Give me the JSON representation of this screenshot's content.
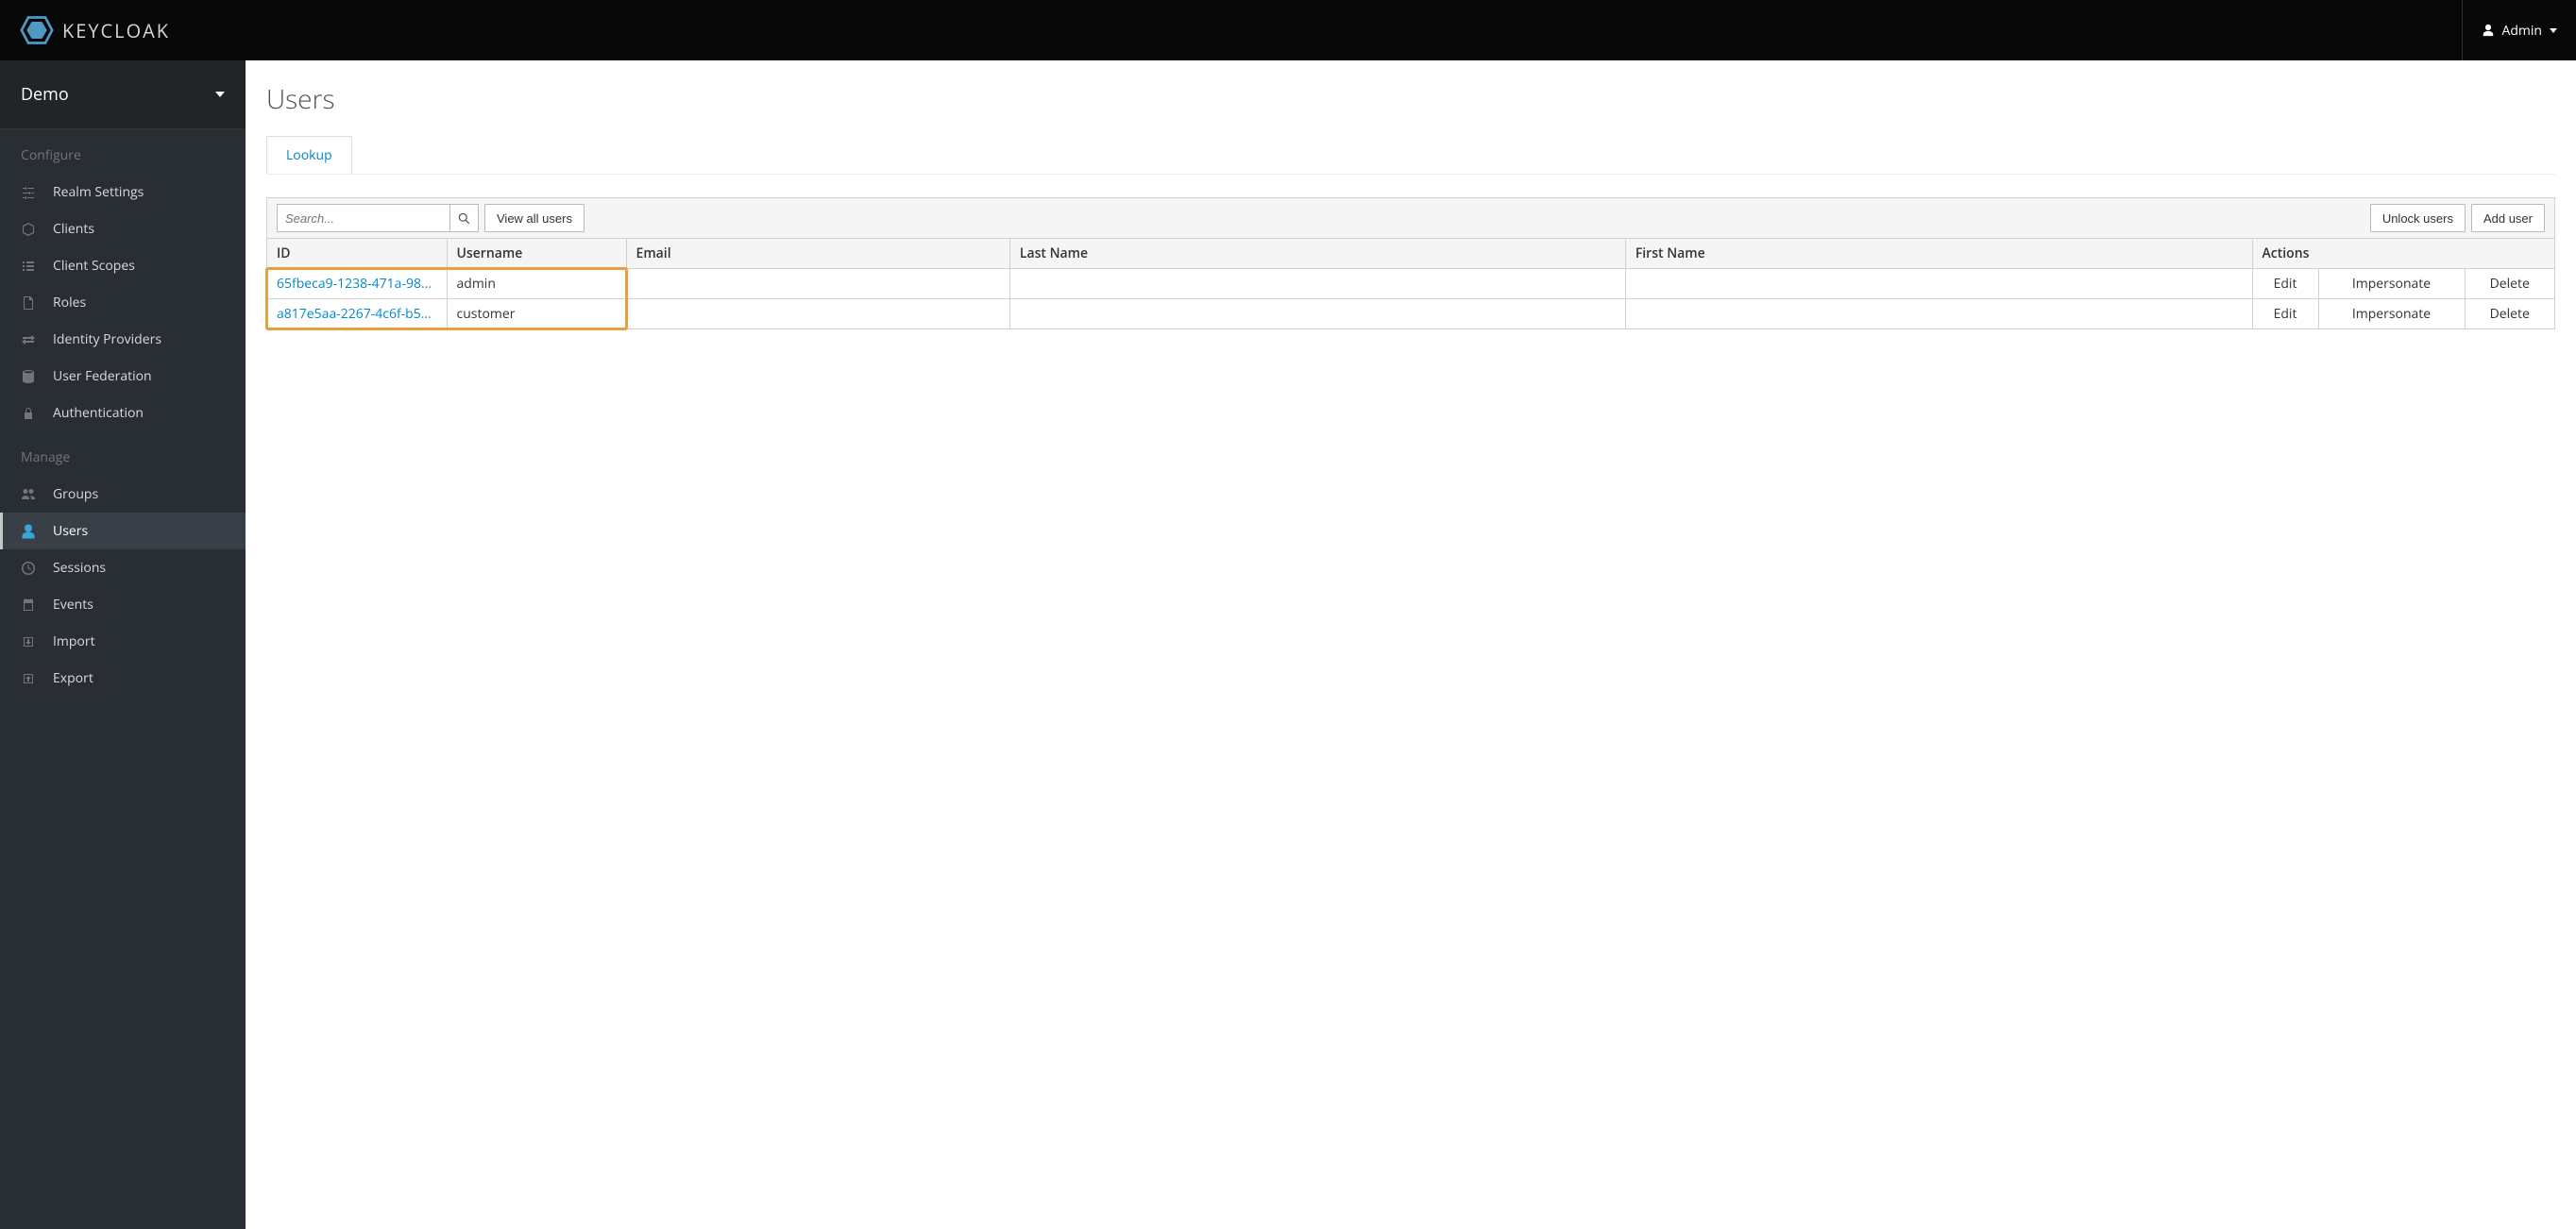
{
  "header": {
    "logo_text": "KEYCLOAK",
    "user": "Admin"
  },
  "sidebar": {
    "realm": "Demo",
    "sections": [
      {
        "title": "Configure",
        "items": [
          {
            "label": "Realm Settings",
            "icon": "sliders",
            "active": false
          },
          {
            "label": "Clients",
            "icon": "cube",
            "active": false
          },
          {
            "label": "Client Scopes",
            "icon": "list",
            "active": false
          },
          {
            "label": "Roles",
            "icon": "file",
            "active": false
          },
          {
            "label": "Identity Providers",
            "icon": "exchange",
            "active": false
          },
          {
            "label": "User Federation",
            "icon": "database",
            "active": false
          },
          {
            "label": "Authentication",
            "icon": "lock",
            "active": false
          }
        ]
      },
      {
        "title": "Manage",
        "items": [
          {
            "label": "Groups",
            "icon": "users",
            "active": false
          },
          {
            "label": "Users",
            "icon": "user",
            "active": true
          },
          {
            "label": "Sessions",
            "icon": "clock",
            "active": false
          },
          {
            "label": "Events",
            "icon": "calendar",
            "active": false
          },
          {
            "label": "Import",
            "icon": "import",
            "active": false
          },
          {
            "label": "Export",
            "icon": "export",
            "active": false
          }
        ]
      }
    ]
  },
  "page": {
    "title": "Users",
    "tabs": [
      "Lookup"
    ]
  },
  "toolbar": {
    "search_placeholder": "Search...",
    "view_all": "View all users",
    "unlock_users": "Unlock users",
    "add_user": "Add user"
  },
  "table": {
    "headers": [
      "ID",
      "Username",
      "Email",
      "Last Name",
      "First Name",
      "Actions"
    ],
    "actions": {
      "edit": "Edit",
      "impersonate": "Impersonate",
      "delete": "Delete"
    },
    "rows": [
      {
        "id": "65fbeca9-1238-471a-98...",
        "username": "admin",
        "email": "",
        "lastName": "",
        "firstName": ""
      },
      {
        "id": "a817e5aa-2267-4c6f-b5...",
        "username": "customer",
        "email": "",
        "lastName": "",
        "firstName": ""
      }
    ]
  }
}
